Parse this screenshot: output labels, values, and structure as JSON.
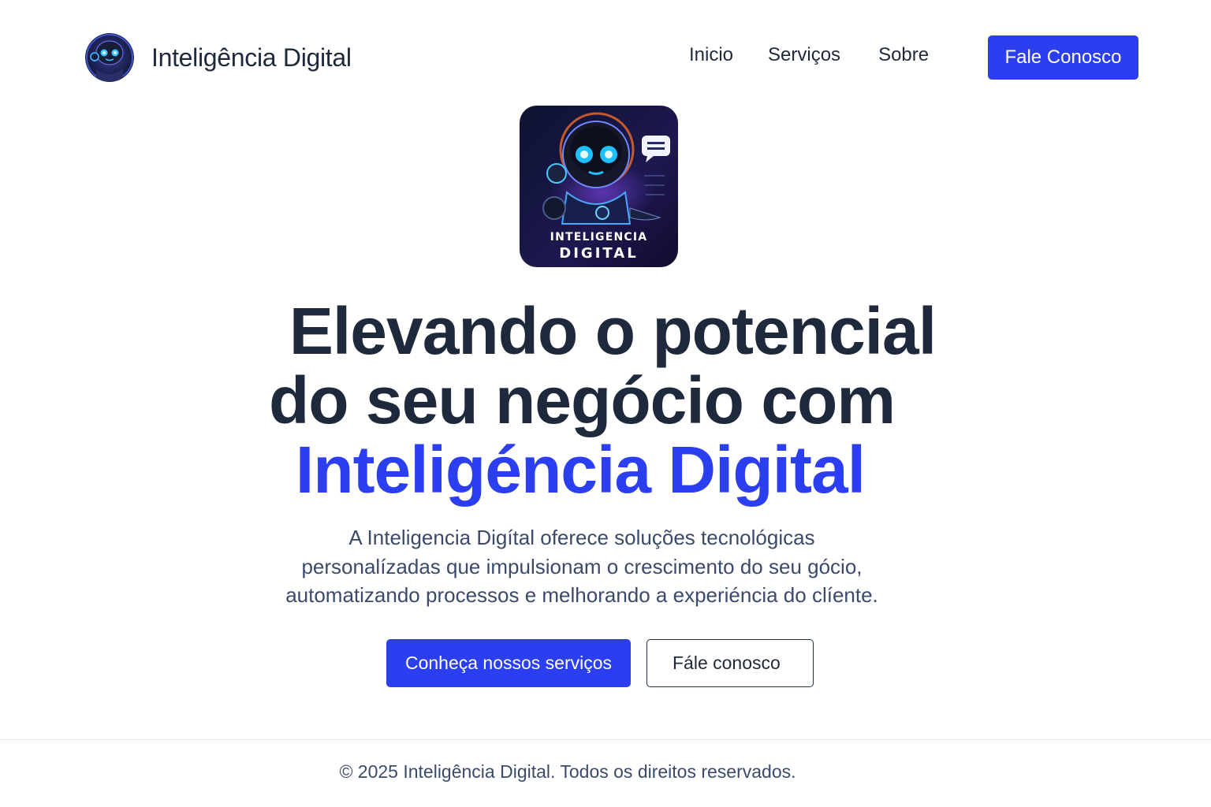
{
  "brand": {
    "name": "Inteligência Digital",
    "logo_icon": "robot-avatar-icon"
  },
  "nav": {
    "items": [
      {
        "label": "Inicio"
      },
      {
        "label": "Serviços"
      },
      {
        "label": "Sobre"
      }
    ],
    "cta_label": "Fale Conosco"
  },
  "hero": {
    "logo_text_line1": "INTELIGENCIA",
    "logo_text_line2": "DIGITAL",
    "headline_line1": "Elevando o potencial",
    "headline_line2": "do seu negócio com",
    "headline_highlight": "Inteligéncia Digital",
    "description_line1": "A Inteligencia Digítal oferece soluções tecnológicas",
    "description_line2": "personalízadas que impulsionam o crescimento do seu gócio,",
    "description_line3": "automatizando processos e melhorando a experiéncia do clíente.",
    "primary_button": "Conheça nossos serviços",
    "secondary_button": "Fále conosco"
  },
  "footer": {
    "copyright": "© 2025 Inteligência Digital. Todos os direitos reservados."
  },
  "colors": {
    "accent": "#2b3ff0",
    "text_dark": "#1e293b",
    "text_muted": "#3b4a6b"
  }
}
